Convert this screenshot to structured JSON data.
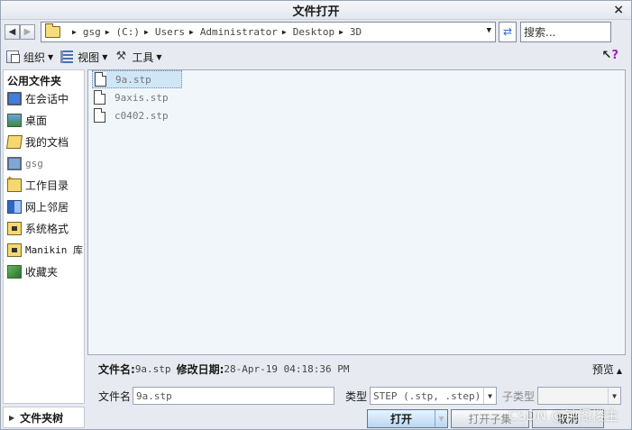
{
  "window": {
    "title": "文件打开",
    "close_glyph": "×"
  },
  "address": {
    "crumbs": [
      "gsg",
      "(C:)",
      "Users",
      "Administrator",
      "Desktop",
      "3D"
    ],
    "search_placeholder": "搜索..."
  },
  "toolbar": {
    "organize_label": "组织",
    "view_label": "视图",
    "tools_label": "工具"
  },
  "sidebar": {
    "title": "公用文件夹",
    "items": [
      {
        "label": "在会话中",
        "icon": "session-monitor-icon"
      },
      {
        "label": "桌面",
        "icon": "desktop-icon"
      },
      {
        "label": "我的文档",
        "icon": "my-documents-icon"
      },
      {
        "label": "gsg",
        "icon": "computer-icon"
      },
      {
        "label": "工作目录",
        "icon": "working-directory-icon"
      },
      {
        "label": "网上邻居",
        "icon": "network-places-icon"
      },
      {
        "label": "系统格式",
        "icon": "system-formats-icon"
      },
      {
        "label": "Manikin 库",
        "icon": "manikin-library-icon"
      },
      {
        "label": "收藏夹",
        "icon": "favorites-icon"
      }
    ],
    "folder_tree_label": "文件夹树"
  },
  "files": [
    {
      "name": "9a.stp",
      "selected": true
    },
    {
      "name": "9axis.stp",
      "selected": false
    },
    {
      "name": "c0402.stp",
      "selected": false
    }
  ],
  "info": {
    "filename_label": "文件名:",
    "filename_value": "9a.stp",
    "modified_label": "修改日期:",
    "modified_value": "28-Apr-19 04:18:36 PM",
    "preview_label": "预览"
  },
  "form": {
    "filename_label": "文件名",
    "filename_value": "9a.stp",
    "type_label": "类型",
    "type_value": "STEP (.stp, .step)",
    "subtype_label": "子类型",
    "subtype_value": ""
  },
  "buttons": {
    "open": "打开",
    "open_subset": "打开子集",
    "cancel": "取消"
  },
  "watermark": "CSDN @钝阁楼主"
}
